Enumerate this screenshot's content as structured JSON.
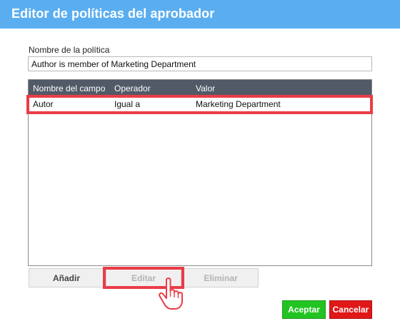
{
  "dialog": {
    "title": "Editor de políticas del aprobador"
  },
  "policy_name": {
    "label": "Nombre de la política",
    "value": "Author is member of Marketing Department"
  },
  "table": {
    "columns": [
      "Nombre del campo",
      "Operador",
      "Valor"
    ],
    "rows": [
      [
        "Autor",
        "Igual a",
        "Marketing Department"
      ]
    ]
  },
  "actions": {
    "add_label": "Añadir",
    "edit_label": "Editar",
    "delete_label": "Eliminar"
  },
  "footer": {
    "ok_label": "Aceptar",
    "cancel_label": "Cancelar"
  },
  "colors": {
    "title_bar": "#5aaef0",
    "table_header": "#515a66",
    "highlight": "#ea3c47",
    "ok": "#22c422",
    "cancel": "#e01818"
  },
  "icons": {
    "cursor": "hand-pointer-icon"
  }
}
